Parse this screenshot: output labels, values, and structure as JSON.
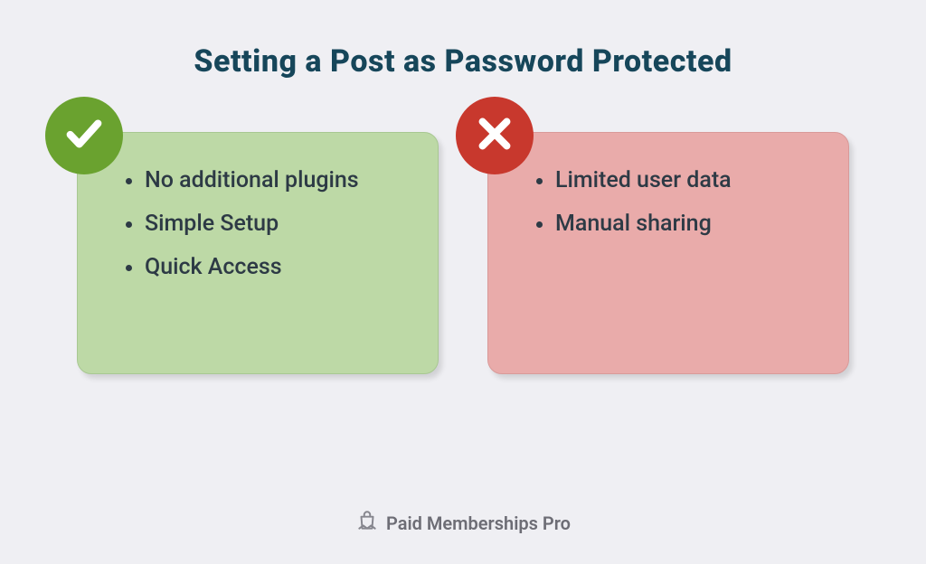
{
  "title": "Setting a Post as Password Protected",
  "pros": {
    "items": [
      "No additional plugins",
      "Simple Setup",
      "Quick Access"
    ]
  },
  "cons": {
    "items": [
      "Limited user data",
      "Manual sharing"
    ]
  },
  "brand": "Paid Memberships Pro",
  "colors": {
    "title": "#16465a",
    "prosBg": "#bdd9a6",
    "consBg": "#e9abaa",
    "checkBadge": "#6aa22f",
    "xBadge": "#c8382d"
  }
}
